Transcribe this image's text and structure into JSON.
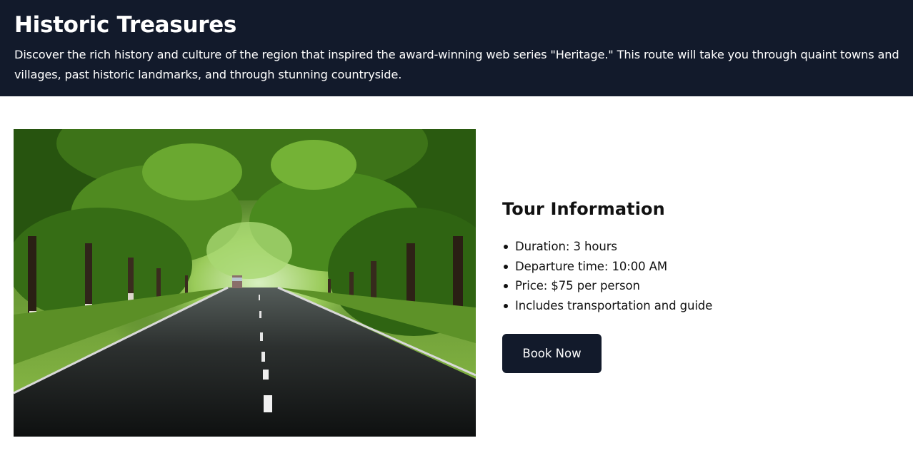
{
  "header": {
    "title": "Historic Treasures",
    "description": "Discover the rich history and culture of the region that inspired the award-winning web series \"Heritage.\" This route will take you through quaint towns and villages, past historic landmarks, and through stunning countryside."
  },
  "tour": {
    "heading": "Tour Information",
    "details": [
      "Duration: 3 hours",
      "Departure time: 10:00 AM",
      "Price: $75 per person",
      "Includes transportation and guide"
    ],
    "book_label": "Book Now"
  },
  "colors": {
    "header_bg": "#121a2b",
    "button_bg": "#121a2b"
  }
}
